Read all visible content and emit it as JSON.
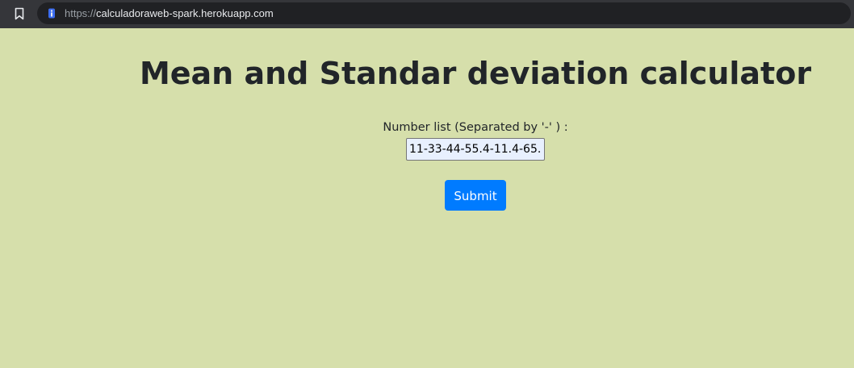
{
  "browser": {
    "url_scheme": "https://",
    "url_host": "calculadoraweb-spark.herokuapp.com"
  },
  "page": {
    "title": "Mean and Standar deviation calculator",
    "number_list_label": "Number list (Separated by '-' ) :",
    "number_list_value": "11-33-44-55.4-11.4-65.",
    "submit_label": "Submit"
  },
  "colors": {
    "page_background": "#d6dfab",
    "button_background": "#007bff",
    "input_autofill_background": "#e8f0fe"
  }
}
